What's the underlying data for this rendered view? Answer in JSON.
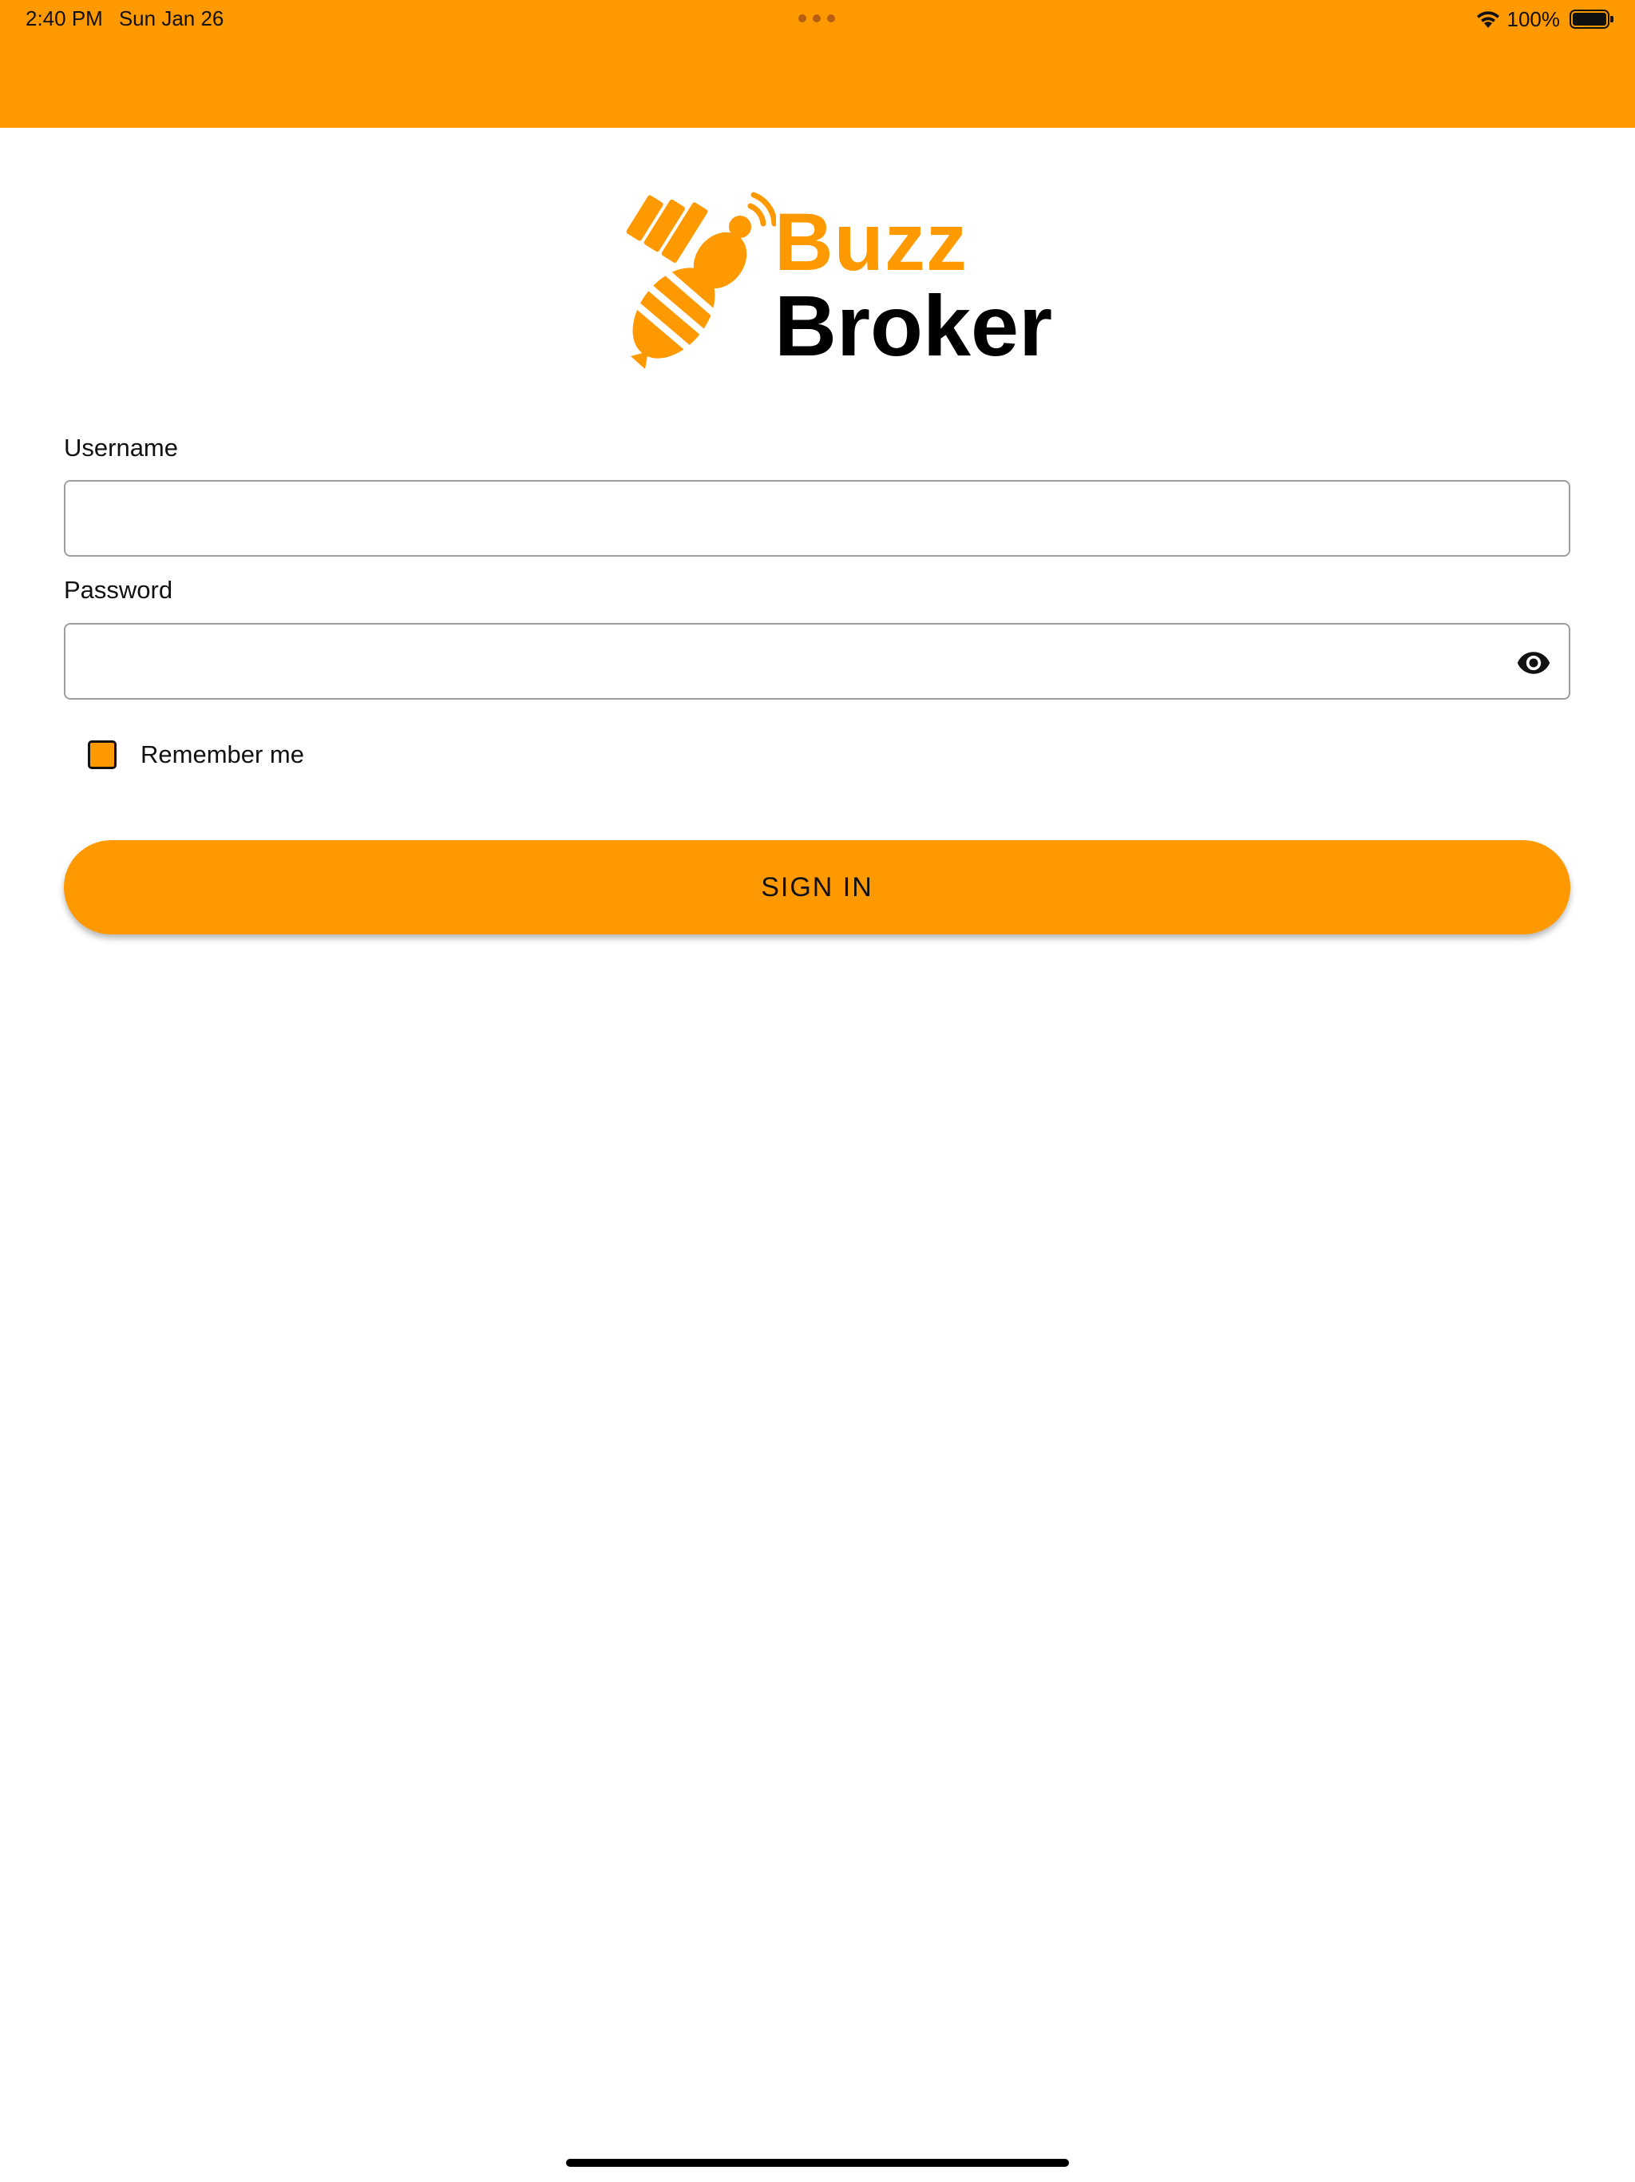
{
  "status_bar": {
    "time": "2:40 PM",
    "date": "Sun Jan 26",
    "battery": "100%",
    "icons": [
      "wifi-icon",
      "battery-icon"
    ]
  },
  "logo": {
    "line1": "Buzz",
    "line2": "Broker",
    "colors": {
      "accent": "#FF9900",
      "text": "#000000"
    }
  },
  "form": {
    "username_label": "Username",
    "username_value": "",
    "password_label": "Password",
    "password_value": "",
    "remember_label": "Remember me",
    "remember_checked": false,
    "submit_label": "SIGN IN"
  },
  "theme": {
    "brand_color": "#FF9900",
    "border_color": "#9E9E9E"
  }
}
